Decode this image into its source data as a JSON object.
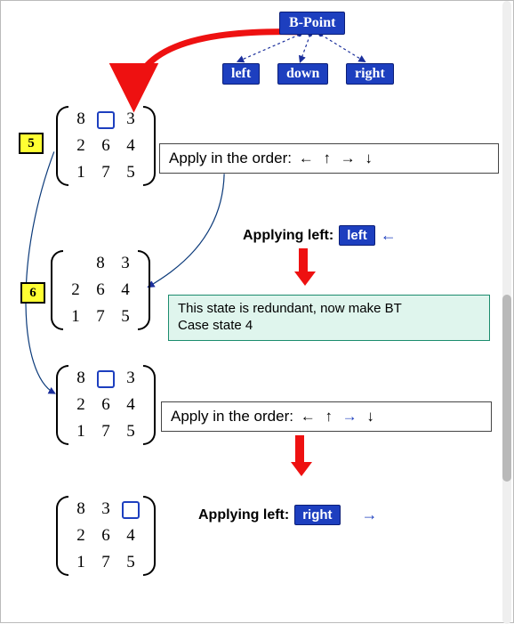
{
  "header": {
    "bpoint": "B-Point",
    "children": [
      "left",
      "down",
      "right"
    ]
  },
  "steps": {
    "five": "5",
    "six": "6"
  },
  "matrices": {
    "m5": [
      [
        "8",
        "□",
        "3"
      ],
      [
        "2",
        "6",
        "4"
      ],
      [
        "1",
        "7",
        "5"
      ]
    ],
    "m6": [
      [
        "",
        "8",
        "3"
      ],
      [
        "2",
        "6",
        "4"
      ],
      [
        "1",
        "7",
        "5"
      ]
    ],
    "m7": [
      [
        "8",
        "□",
        "3"
      ],
      [
        "2",
        "6",
        "4"
      ],
      [
        "1",
        "7",
        "5"
      ]
    ],
    "m8": [
      [
        "8",
        "3",
        "□"
      ],
      [
        "2",
        "6",
        "4"
      ],
      [
        "1",
        "7",
        "5"
      ]
    ]
  },
  "order": {
    "label": "Apply in the order:",
    "seq": [
      "←",
      "↑",
      "→",
      "↓"
    ]
  },
  "applying": {
    "left_label": "Applying left:",
    "left_tag": "left",
    "left_arrow": "←",
    "right_label": "Applying left:",
    "right_tag": "right",
    "right_arrow": "→"
  },
  "info": {
    "line1": "This state is redundant, now make BT",
    "line2": "Case state 4"
  },
  "icons": {
    "blank": "□"
  }
}
